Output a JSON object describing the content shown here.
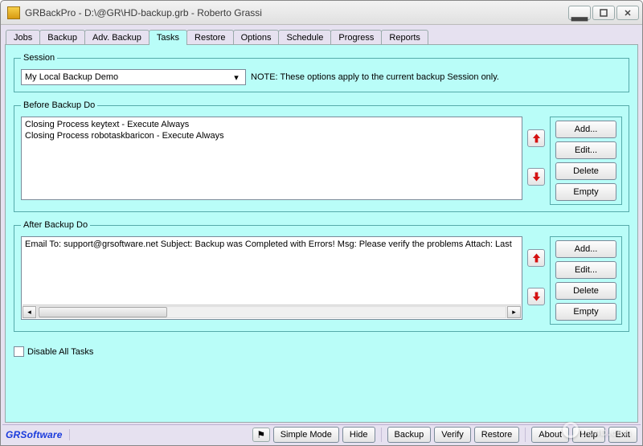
{
  "window": {
    "title": "GRBackPro - D:\\@GR\\HD-backup.grb - Roberto Grassi"
  },
  "tabs": [
    "Jobs",
    "Backup",
    "Adv. Backup",
    "Tasks",
    "Restore",
    "Options",
    "Schedule",
    "Progress",
    "Reports"
  ],
  "active_tab_index": 3,
  "session": {
    "legend": "Session",
    "selected": "My Local Backup Demo",
    "note": "NOTE: These options apply to the current backup Session only."
  },
  "before": {
    "legend": "Before Backup Do",
    "items": [
      "Closing Process keytext - Execute Always",
      "Closing Process robotaskbaricon - Execute Always"
    ]
  },
  "after": {
    "legend": "After Backup Do",
    "items": [
      "Email To: support@grsoftware.net Subject: Backup was Completed with Errors! Msg: Please verify the problems Attach: Last"
    ]
  },
  "action_buttons": {
    "add": "Add...",
    "edit": "Edit...",
    "delete": "Delete",
    "empty": "Empty"
  },
  "disable_all": "Disable All Tasks",
  "statusbar": {
    "brand": "GRSoftware",
    "simple_mode": "Simple Mode",
    "hide": "Hide",
    "backup": "Backup",
    "verify": "Verify",
    "restore": "Restore",
    "about": "About",
    "help": "Help",
    "exit": "Exit"
  },
  "watermark": "LO4D.com"
}
